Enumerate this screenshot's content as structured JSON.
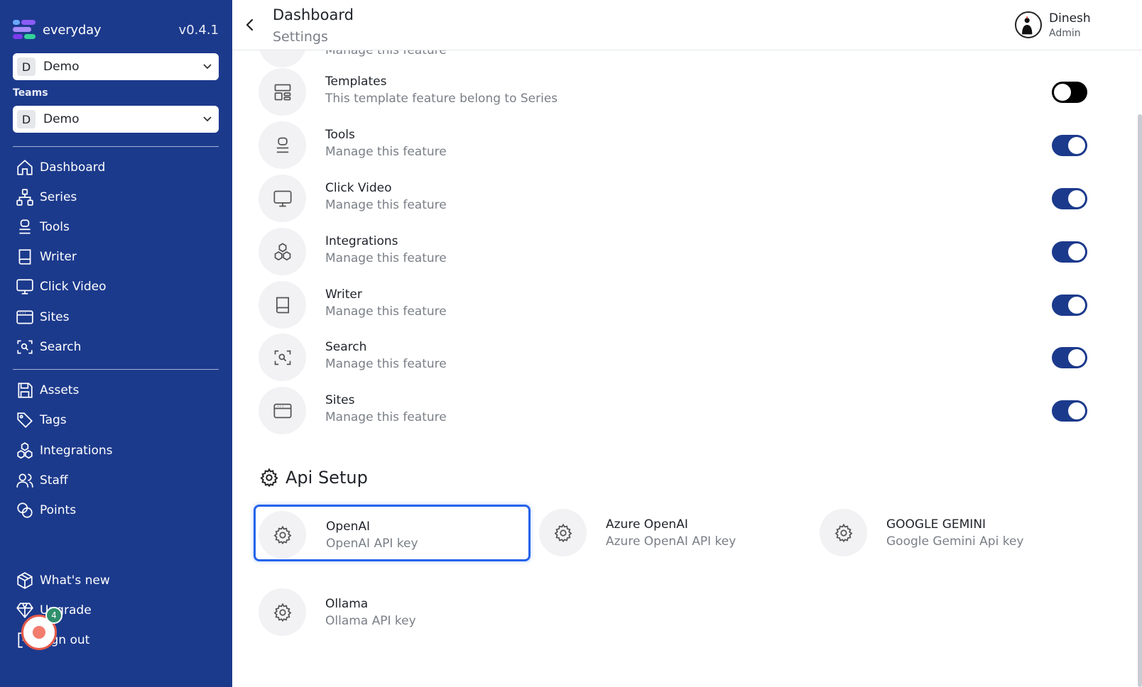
{
  "app": {
    "name": "everyday",
    "version": "v0.4.1"
  },
  "workspace_select": {
    "badge": "D",
    "value": "Demo"
  },
  "teams": {
    "label": "Teams",
    "badge": "D",
    "value": "Demo"
  },
  "nav_primary": [
    {
      "label": "Dashboard",
      "icon": "home-icon"
    },
    {
      "label": "Series",
      "icon": "hierarchy-icon"
    },
    {
      "label": "Tools",
      "icon": "stack-icon"
    },
    {
      "label": "Writer",
      "icon": "book-icon"
    },
    {
      "label": "Click Video",
      "icon": "monitor-icon"
    },
    {
      "label": "Sites",
      "icon": "browser-icon"
    },
    {
      "label": "Search",
      "icon": "scan-search-icon"
    }
  ],
  "nav_secondary": [
    {
      "label": "Assets",
      "icon": "save-icon"
    },
    {
      "label": "Tags",
      "icon": "tag-icon"
    },
    {
      "label": "Integrations",
      "icon": "cubes-icon"
    },
    {
      "label": "Staff",
      "icon": "users-icon"
    },
    {
      "label": "Points",
      "icon": "coins-icon"
    }
  ],
  "nav_bottom": [
    {
      "label": "What's new",
      "icon": "package-icon"
    },
    {
      "label": "Upgrade",
      "icon": "diamond-icon"
    },
    {
      "label": "Sign out",
      "icon": "logout-icon"
    }
  ],
  "notification": {
    "count": "4"
  },
  "header": {
    "title": "Dashboard",
    "subtitle": "Settings"
  },
  "user": {
    "name": "Dinesh",
    "role": "Admin"
  },
  "features": {
    "partial_desc": "Manage this feature",
    "items": [
      {
        "title": "Templates",
        "desc": "This template feature belong to Series",
        "icon": "layout-icon",
        "enabled": false
      },
      {
        "title": "Tools",
        "desc": "Manage this feature",
        "icon": "stack-icon",
        "enabled": true
      },
      {
        "title": "Click Video",
        "desc": "Manage this feature",
        "icon": "monitor-icon",
        "enabled": true
      },
      {
        "title": "Integrations",
        "desc": "Manage this feature",
        "icon": "cubes-icon",
        "enabled": true
      },
      {
        "title": "Writer",
        "desc": "Manage this feature",
        "icon": "book-icon",
        "enabled": true
      },
      {
        "title": "Search",
        "desc": "Manage this feature",
        "icon": "scan-search-icon",
        "enabled": true
      },
      {
        "title": "Sites",
        "desc": "Manage this feature",
        "icon": "browser-icon",
        "enabled": true
      }
    ]
  },
  "api_setup": {
    "title": "Api Setup",
    "providers": [
      {
        "title": "OpenAI",
        "desc": "OpenAI API key",
        "active": true
      },
      {
        "title": "Azure OpenAI",
        "desc": "Azure OpenAI API key",
        "active": false
      },
      {
        "title": "GOOGLE GEMINI",
        "desc": "Google Gemini Api key",
        "active": false
      },
      {
        "title": "Ollama",
        "desc": "Ollama API key",
        "active": false
      }
    ]
  },
  "colors": {
    "sidebar": "#1c3a8c",
    "toggle_on": "#1c3a8c",
    "toggle_off": "#000000",
    "active_border": "#2563eb",
    "badge_green": "#2f8f6b",
    "fab_red": "#e55a4a"
  }
}
